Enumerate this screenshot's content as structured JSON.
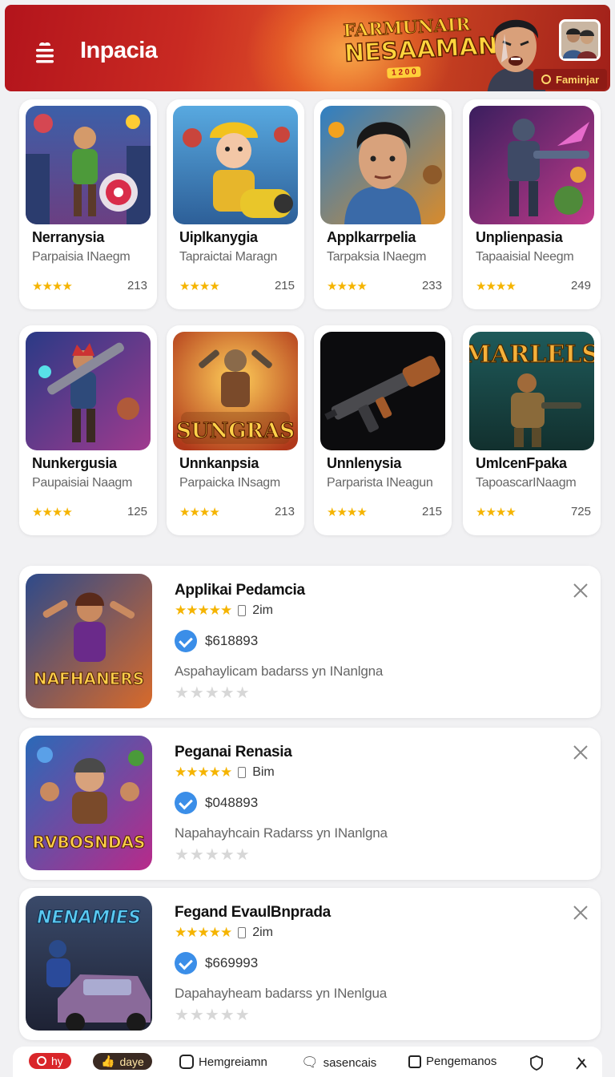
{
  "header": {
    "brand": "Inpacia",
    "banner_line1": "FARMUNAIR",
    "banner_line2": "NESAAMAN",
    "banner_line3": "1 2 0 0",
    "feature_button": "Faminjar"
  },
  "grid": [
    {
      "title": "Nerranysia",
      "sub": "Parpaisia INaegm",
      "stars": "★★★★",
      "count": "213"
    },
    {
      "title": "Uiplkanygia",
      "sub": "Tapraictai Maragn",
      "stars": "★★★★",
      "count": "215"
    },
    {
      "title": "Applkarrpelia",
      "sub": "Tarpaksia INaegm",
      "stars": "★★★★",
      "count": "233"
    },
    {
      "title": "Unplienpasia",
      "sub": "Tapaaisial Neegm",
      "stars": "★★★★",
      "count": "249"
    },
    {
      "title": "Nunkergusia",
      "sub": "Paupaisiai Naagm",
      "stars": "★★★★",
      "count": "125"
    },
    {
      "title": "Unnkanpsia",
      "sub": "Parpaicka INsagm",
      "stars": "★★★★",
      "count": "213"
    },
    {
      "title": "Unnlenysia",
      "sub": "Parparista INeagun",
      "stars": "★★★★",
      "count": "215"
    },
    {
      "title": "UmlcenFpaka",
      "sub": "TapoascarINaagm",
      "stars": "★★★★",
      "count": "725"
    }
  ],
  "grid_labels": {
    "sungras": "SUNGRAS",
    "marlels": "MARLELS"
  },
  "list": [
    {
      "title": "Applikai Pedamcia",
      "stars": "★★★★★",
      "meta": "2im",
      "price": "$618893",
      "desc": "Aspahaylicam badarss yn INanlgna",
      "empty_stars": "★★★★★",
      "thumb_text": "NAFHANERS"
    },
    {
      "title": "Peganai Renasia",
      "stars": "★★★★★",
      "meta": "Bim",
      "price": "$048893",
      "desc": "Napahayhcain Radarss yn INanlgna",
      "empty_stars": "★★★★★",
      "thumb_text": "RVBOSNDAS"
    },
    {
      "title": "Fegand EvaulBnprada",
      "stars": "★★★★★",
      "meta": "2im",
      "price": "$669993",
      "desc": "Dapahayheam badarss yn INenlgua",
      "empty_stars": "★★★★★",
      "thumb_text": "NENAMIES"
    }
  ],
  "bottom_bar": {
    "item1": "hy",
    "item2": "daye",
    "item3": "Hemgreiamn",
    "item4": "sasencais",
    "item5": "Pengemanos"
  },
  "colors": {
    "accent_red": "#d9262a",
    "star": "#f5b400",
    "verified": "#3b8ee8"
  }
}
